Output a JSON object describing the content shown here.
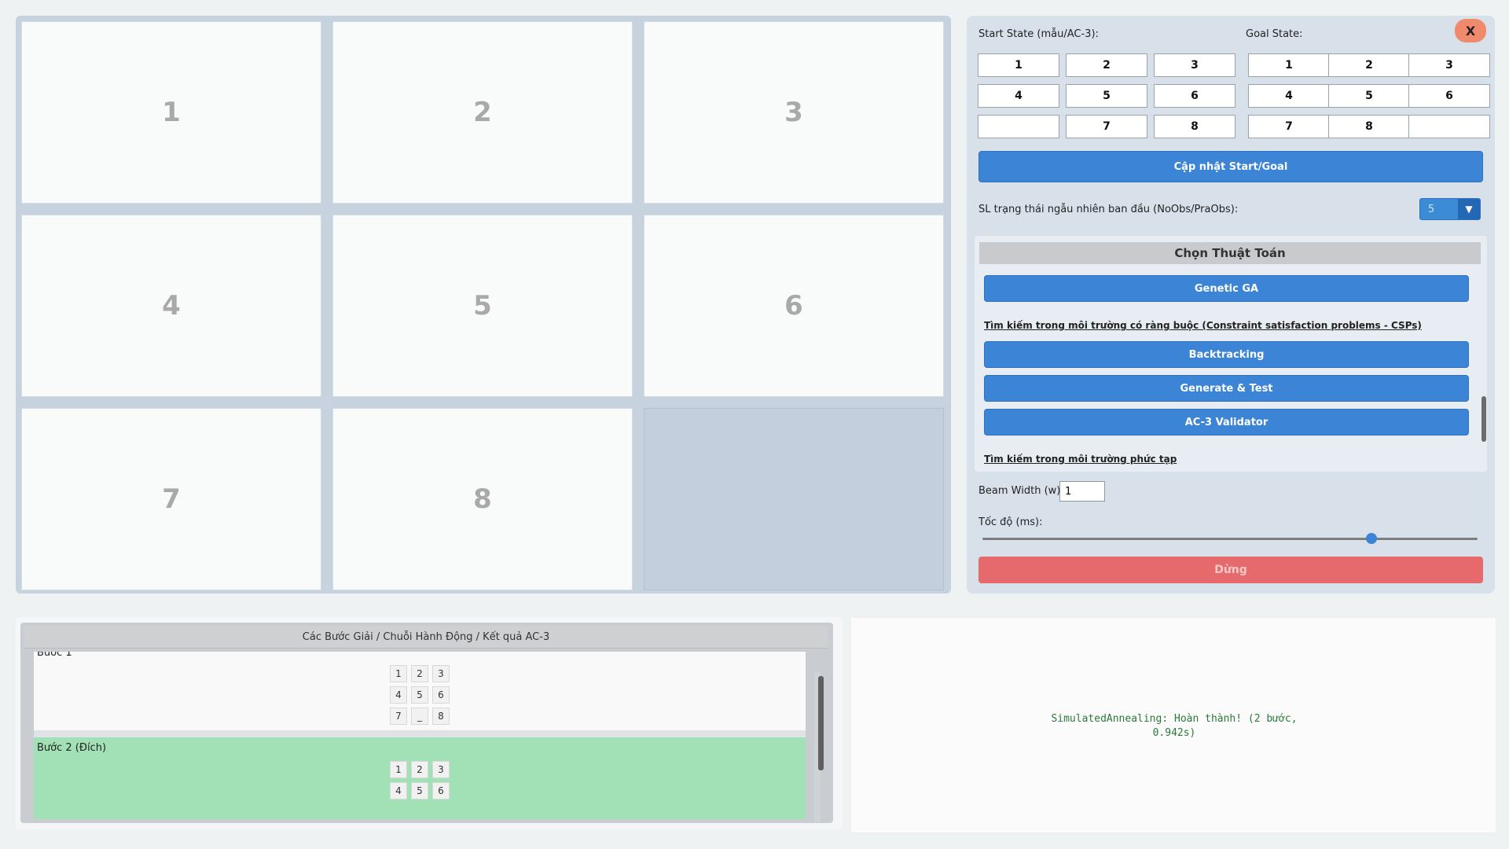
{
  "board": {
    "tiles": [
      "1",
      "2",
      "3",
      "4",
      "5",
      "6",
      "7",
      "8",
      ""
    ]
  },
  "panel": {
    "close_label": "X",
    "start_label": "Start State (mẫu/AC-3):",
    "goal_label": "Goal State:",
    "start_cells": [
      "1",
      "2",
      "3",
      "4",
      "5",
      "6",
      "",
      "7",
      "8"
    ],
    "goal_cells": [
      "1",
      "2",
      "3",
      "4",
      "5",
      "6",
      "7",
      "8",
      ""
    ],
    "update_button": "Cập nhật Start/Goal",
    "random_label": "SL trạng thái ngẫu nhiên ban đầu (NoObs/PraObs):",
    "random_value": "5",
    "algo_header": "Chọn Thuật Toán",
    "genetic_button": "Genetic GA",
    "csp_section": "Tìm kiếm trong môi trường có ràng buộc (Constraint satisfaction problems - CSPs)",
    "backtracking_button": "Backtracking",
    "generate_test_button": "Generate & Test",
    "ac3_button": "AC-3 Validator",
    "complex_section": "Tìm kiếm trong môi trường phức tạp",
    "beam_label": "Beam Width (w):",
    "beam_value": "1",
    "speed_label": "Tốc độ (ms):",
    "speed_level": 0.8,
    "stop_button": "Dừng",
    "accent_color": "#3b84d6",
    "stop_color": "#e66a6c"
  },
  "steps": {
    "header": "Các Bước Giải / Chuỗi Hành Động / Kết quả AC-3",
    "items": [
      {
        "title": "Bước 1",
        "cells": [
          "1",
          "2",
          "3",
          "4",
          "5",
          "6",
          "7",
          "_",
          "8"
        ]
      },
      {
        "title": "Bước 2 (Đích)",
        "cells": [
          "1",
          "2",
          "3",
          "4",
          "5",
          "6"
        ],
        "highlight_color": "#a2e1b5"
      }
    ]
  },
  "status": {
    "line1": "SimulatedAnnealing: Hoàn thành! (2 bước,",
    "line2": "0.942s)",
    "color": "#2a7a3a"
  }
}
